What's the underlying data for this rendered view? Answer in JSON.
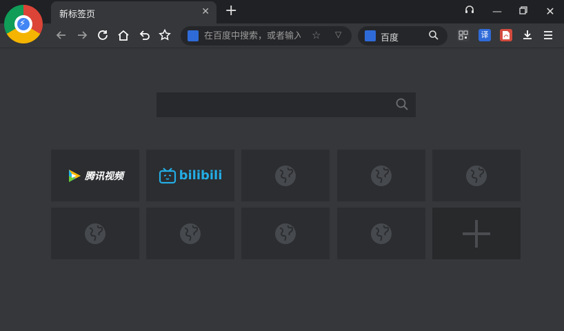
{
  "window": {
    "tab_title": "新标签页"
  },
  "toolbar": {
    "address_placeholder": "在百度中搜索，或者输入网址",
    "search_engine_name": "百度",
    "ext_translate_label": "译"
  },
  "page": {
    "search_placeholder": ""
  },
  "speed_dial": [
    {
      "type": "site",
      "label": "腾讯视频",
      "icon": "tencent-video-logo"
    },
    {
      "type": "site",
      "label": "bilibili",
      "icon": "bilibili-logo"
    },
    {
      "type": "empty",
      "icon": "globe-icon"
    },
    {
      "type": "empty",
      "icon": "globe-icon"
    },
    {
      "type": "empty",
      "icon": "globe-icon"
    },
    {
      "type": "empty",
      "icon": "globe-icon"
    },
    {
      "type": "empty",
      "icon": "globe-icon"
    },
    {
      "type": "empty",
      "icon": "globe-icon"
    },
    {
      "type": "empty",
      "icon": "globe-icon"
    },
    {
      "type": "add",
      "icon": "plus-icon"
    }
  ],
  "colors": {
    "page_bg": "#35373a",
    "titlebar_bg": "#202124",
    "tile_bg": "#2b2d30",
    "accent_blue": "#23ade5"
  }
}
